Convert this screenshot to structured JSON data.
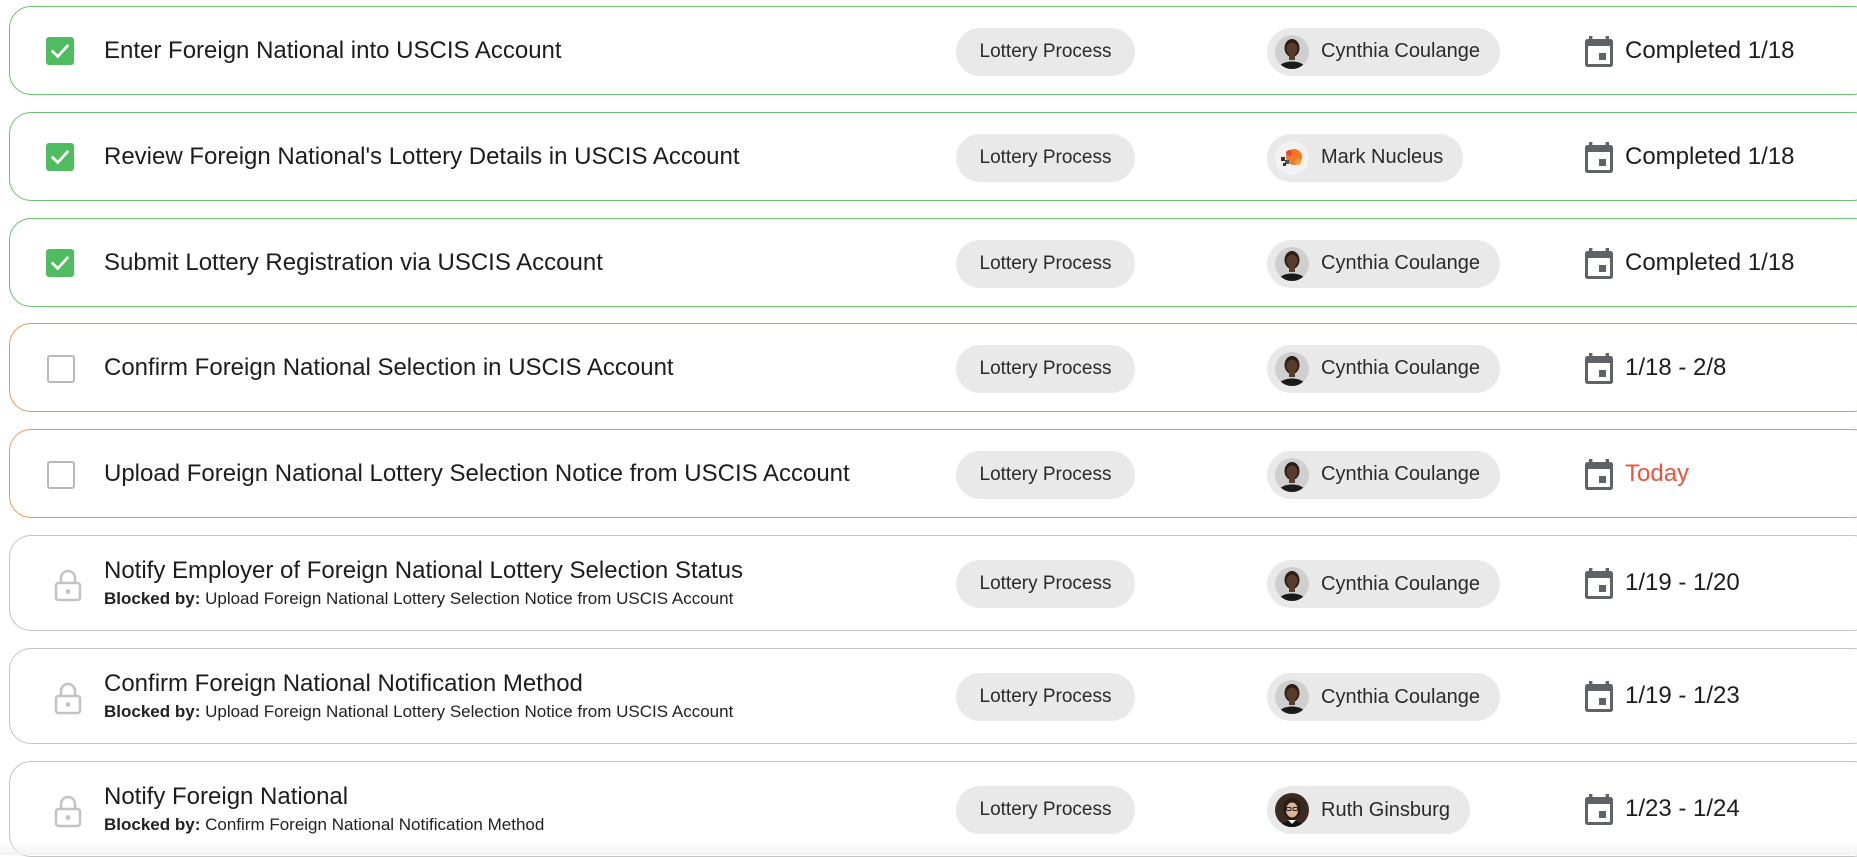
{
  "tasks": [
    {
      "status": "done",
      "title": "Enter Foreign National into USCIS Account",
      "blocked_label": "",
      "blocked_by": "",
      "tag": "Lottery Process",
      "assignee": "Cynthia Coulange",
      "avatar": "avatar-dark",
      "date": "Completed 1/18",
      "date_style": "normal"
    },
    {
      "status": "done",
      "title": "Review Foreign National's Lottery Details in USCIS Account",
      "blocked_label": "",
      "blocked_by": "",
      "tag": "Lottery Process",
      "assignee": "Mark Nucleus",
      "avatar": "avatar-logo",
      "date": "Completed 1/18",
      "date_style": "normal"
    },
    {
      "status": "done",
      "title": "Submit Lottery Registration via USCIS Account",
      "blocked_label": "",
      "blocked_by": "",
      "tag": "Lottery Process",
      "assignee": "Cynthia Coulange",
      "avatar": "avatar-dark",
      "date": "Completed 1/18",
      "date_style": "normal"
    },
    {
      "status": "pending",
      "title": "Confirm Foreign National Selection in USCIS Account",
      "blocked_label": "",
      "blocked_by": "",
      "tag": "Lottery Process",
      "assignee": "Cynthia Coulange",
      "avatar": "avatar-dark",
      "date": "1/18 - 2/8",
      "date_style": "normal"
    },
    {
      "status": "pending",
      "title": "Upload Foreign National Lottery Selection Notice from USCIS Account",
      "blocked_label": "",
      "blocked_by": "",
      "tag": "Lottery Process",
      "assignee": "Cynthia Coulange",
      "avatar": "avatar-dark",
      "date": "Today",
      "date_style": "today"
    },
    {
      "status": "blocked",
      "title": "Notify Employer of Foreign National Lottery Selection Status",
      "blocked_label": "Blocked by:",
      "blocked_by": "Upload Foreign National Lottery Selection Notice from USCIS Account",
      "tag": "Lottery Process",
      "assignee": "Cynthia Coulange",
      "avatar": "avatar-dark",
      "date": "1/19 - 1/20",
      "date_style": "normal"
    },
    {
      "status": "blocked",
      "title": "Confirm Foreign National Notification Method",
      "blocked_label": "Blocked by:",
      "blocked_by": "Upload Foreign National Lottery Selection Notice from USCIS Account",
      "tag": "Lottery Process",
      "assignee": "Cynthia Coulange",
      "avatar": "avatar-dark",
      "date": "1/19 - 1/23",
      "date_style": "normal"
    },
    {
      "status": "blocked",
      "title": "Notify Foreign National",
      "blocked_label": "Blocked by:",
      "blocked_by": "Confirm Foreign National Notification Method",
      "tag": "Lottery Process",
      "assignee": "Ruth Ginsburg",
      "avatar": "avatar-photo",
      "date": "1/23 - 1/24",
      "date_style": "normal"
    }
  ],
  "colors": {
    "done_border": "#6cc070",
    "pending_border": "#f0955a",
    "blocked_border": "#c4c4c4",
    "check_fill": "#4fbd5f",
    "today": "#e8553f"
  },
  "icons": {
    "done": "checkbox-checked-icon",
    "pending": "checkbox-empty-icon",
    "blocked": "lock-icon",
    "date": "calendar-icon"
  }
}
